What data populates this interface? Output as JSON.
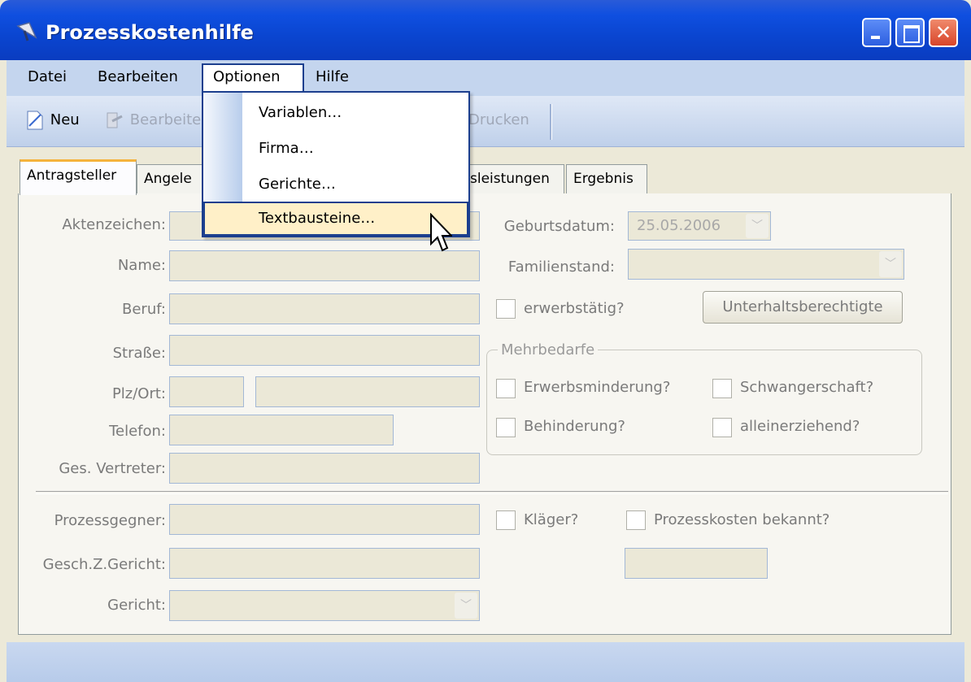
{
  "window": {
    "title": "Prozesskostenhilfe"
  },
  "menu": {
    "items": [
      "Datei",
      "Bearbeiten",
      "Optionen",
      "Hilfe"
    ],
    "active": "Optionen",
    "dropdown": [
      "Variablen…",
      "Firma…",
      "Gerichte…",
      "Textbausteine…"
    ],
    "highlighted": "Textbausteine…"
  },
  "toolbar": {
    "new": "Neu",
    "edit": "Bearbeiten",
    "print": "Drucken"
  },
  "tabs": [
    "Antragsteller",
    "Angele",
    "sleistungen",
    "Ergebnis"
  ],
  "form": {
    "aktenzeichen_label": "Aktenzeichen:",
    "name_label": "Name:",
    "beruf_label": "Beruf:",
    "strasse_label": "Straße:",
    "plzort_label": "Plz/Ort:",
    "telefon_label": "Telefon:",
    "vertreter_label": "Ges. Vertreter:",
    "geburtsdatum_label": "Geburtsdatum:",
    "geburtsdatum_value": "25.05.2006",
    "familienstand_label": "Familienstand:",
    "erwerbstaetig_label": "erwerbstätig?",
    "unterhalt_button": "Unterhaltsberechtigte",
    "mehrbedarfe_title": "Mehrbedarfe",
    "erwerbsminderung": "Erwerbsminderung?",
    "schwangerschaft": "Schwangerschaft?",
    "behinderung": "Behinderung?",
    "alleinerziehend": "alleinerziehend?",
    "prozessgegner_label": "Prozessgegner:",
    "kläger": "Kläger?",
    "prozesskosten_bekannt": "Prozesskosten bekannt?",
    "geschz_label": "Gesch.Z.Gericht:",
    "gericht_label": "Gericht:"
  },
  "colors": {
    "titlebar": "#0a45d0",
    "menubar": "#c4d5ee",
    "highlight": "#fff0c8",
    "tab_accent": "#f5b33c"
  }
}
